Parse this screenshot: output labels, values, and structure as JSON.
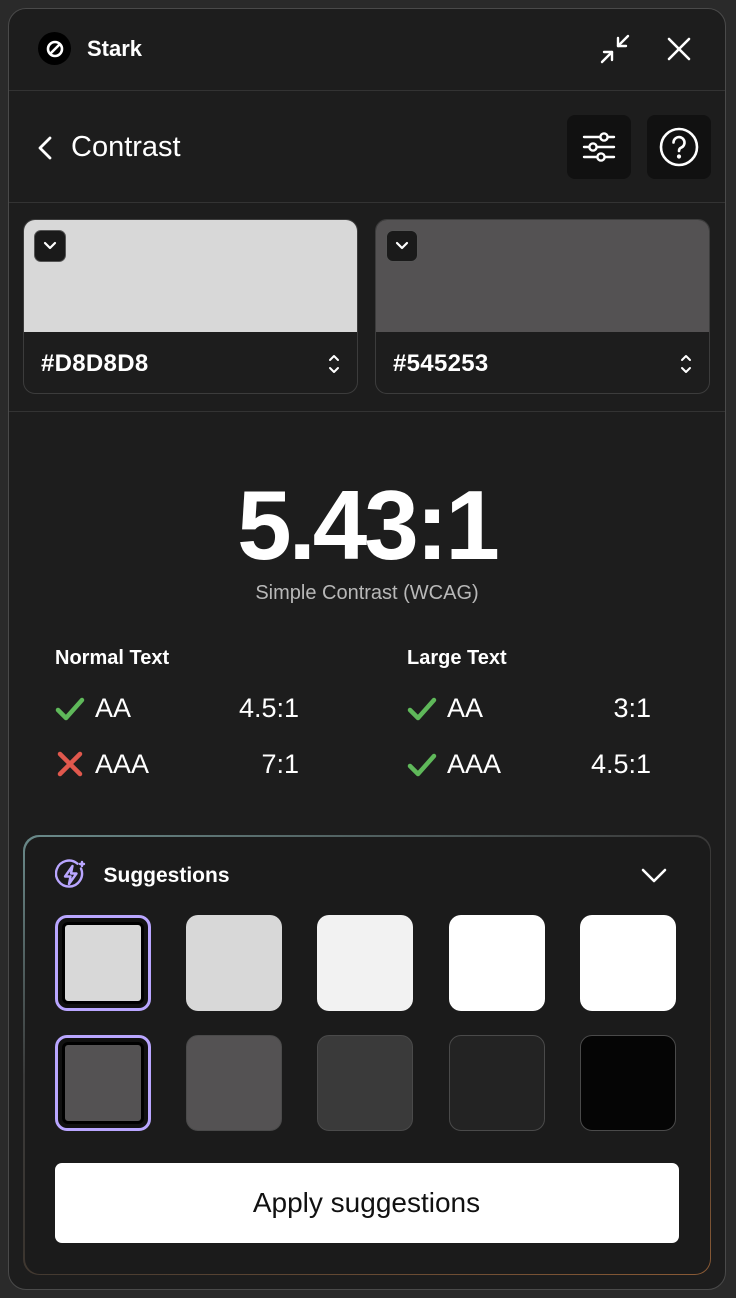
{
  "app": {
    "title": "Stark"
  },
  "header": {
    "title": "Contrast"
  },
  "colors": {
    "foreground": {
      "hex": "#D8D8D8",
      "swatch": "#D8D8D8"
    },
    "background": {
      "hex": "#545253",
      "swatch": "#545253"
    }
  },
  "result": {
    "ratio": "5.43:1",
    "label": "Simple Contrast (WCAG)"
  },
  "normal_text": {
    "heading": "Normal Text",
    "rows": [
      {
        "level": "AA",
        "ratio": "4.5:1",
        "pass": true
      },
      {
        "level": "AAA",
        "ratio": "7:1",
        "pass": false
      }
    ]
  },
  "large_text": {
    "heading": "Large Text",
    "rows": [
      {
        "level": "AA",
        "ratio": "3:1",
        "pass": true
      },
      {
        "level": "AAA",
        "ratio": "4.5:1",
        "pass": true
      }
    ]
  },
  "suggestions": {
    "title": "Suggestions",
    "foreground_swatches": [
      "#D8D8D8",
      "#D8D8D8",
      "#F2F2F2",
      "#FFFFFF",
      "#FFFFFF"
    ],
    "background_swatches": [
      "#545253",
      "#545253",
      "#3A3A3A",
      "#232323",
      "#050505"
    ],
    "apply_label": "Apply suggestions"
  },
  "icons": {
    "logo": "stark-logo-icon",
    "collapse": "collapse-arrows-icon",
    "close": "close-icon",
    "back": "chevron-left-icon",
    "settings": "sliders-icon",
    "help": "help-circle-icon",
    "pass": "check-icon",
    "fail": "x-icon",
    "suggestions": "lightning-circle-icon",
    "expand": "chevron-down-icon"
  },
  "status_colors": {
    "pass": "#5fb85a",
    "fail": "#e0584d",
    "accent": "#b9a6ff"
  }
}
